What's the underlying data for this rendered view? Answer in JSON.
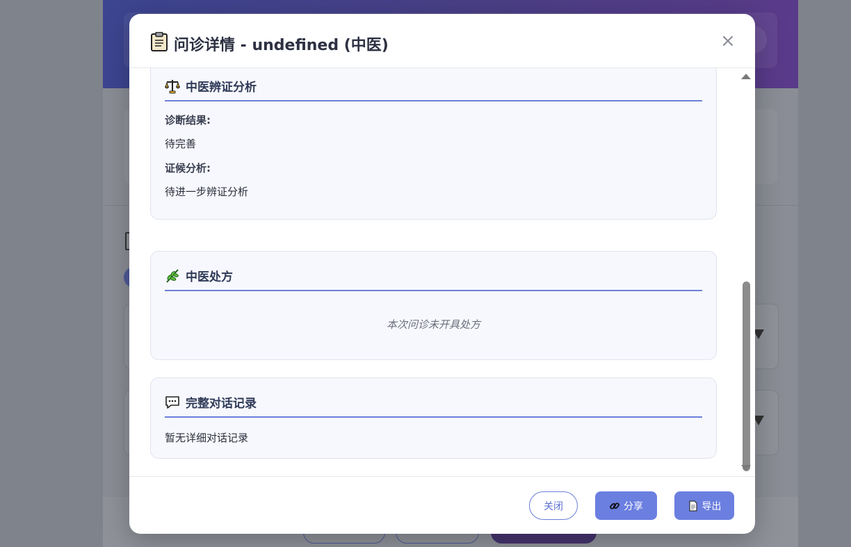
{
  "modal": {
    "title_icon": "clipboard-icon",
    "title": "问诊详情 - undefined (中医)",
    "close_label": "×"
  },
  "sections": {
    "analysis": {
      "icon": "scales-icon",
      "title": "中医辨证分析",
      "diagnosis_label": "诊断结果:",
      "diagnosis_value": "待完善",
      "syndrome_label": "证候分析:",
      "syndrome_value": "待进一步辨证分析"
    },
    "prescription": {
      "icon": "herb-icon",
      "title": "中医处方",
      "empty_text": "本次问诊未开具处方"
    },
    "dialogue": {
      "icon": "speech-bubble-icon",
      "title": "完整对话记录",
      "empty_text": "暂无详细对话记录"
    }
  },
  "footer": {
    "close_label": "关闭",
    "share_label": "分享",
    "share_icon": "link-icon",
    "export_label": "导出",
    "export_icon": "document-icon"
  },
  "colors": {
    "accent": "#6b7fe0",
    "section_bg": "#f7f8fd",
    "header_gradient_start": "#3c4590",
    "header_gradient_end": "#5a3a8a"
  }
}
